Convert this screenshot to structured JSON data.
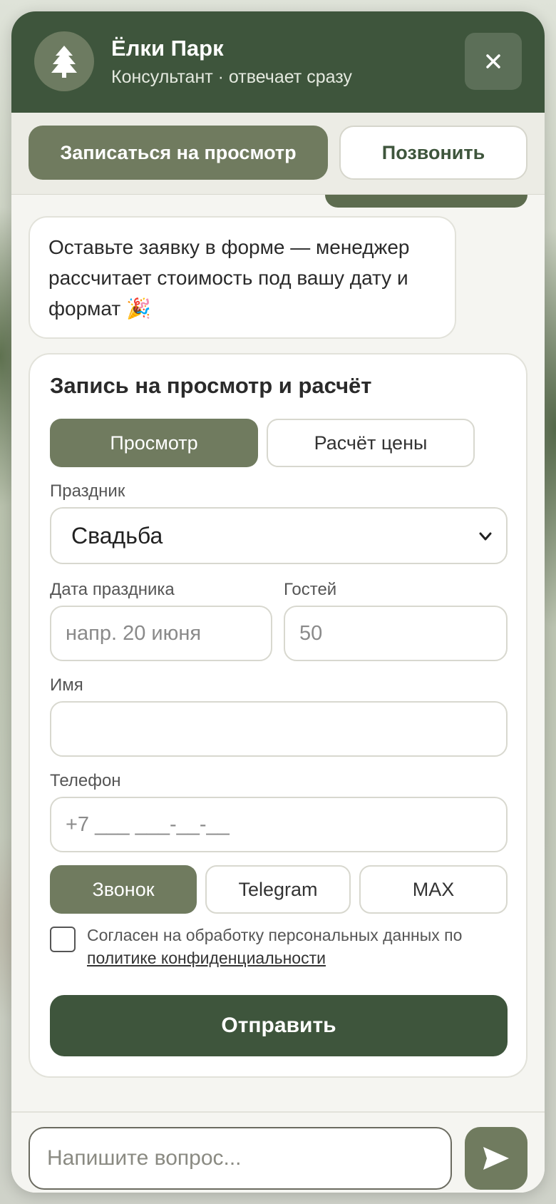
{
  "header": {
    "title": "Ёлки Парк",
    "subtitle": "Консультант · отвечает сразу",
    "avatar_icon": "tree-icon",
    "close_icon": "close-icon"
  },
  "quick_actions": {
    "primary_label": "Записаться на просмотр",
    "secondary_label": "Позвонить"
  },
  "messages": [
    {
      "text": "Оставьте заявку в форме — менеджер рассчитает стоимость под вашу дату и формат 🎉"
    }
  ],
  "form": {
    "title": "Запись на просмотр и расчёт",
    "tabs": [
      {
        "label": "Просмотр",
        "active": true
      },
      {
        "label": "Расчёт цены",
        "active": false
      }
    ],
    "holiday_label": "Праздник",
    "holiday_value": "Свадьба",
    "date_label": "Дата праздника",
    "date_placeholder": "напр. 20 июня",
    "guests_label": "Гостей",
    "guests_placeholder": "50",
    "name_label": "Имя",
    "name_value": "",
    "phone_label": "Телефон",
    "phone_placeholder": "+7 ___ ___-__-__",
    "contact_methods": [
      {
        "label": "Звонок",
        "active": true
      },
      {
        "label": "Telegram",
        "active": false
      },
      {
        "label": "MAX",
        "active": false
      }
    ],
    "consent_text": "Согласен на обработку персональных данных по",
    "consent_link": "политике конфиденциальности",
    "consent_checked": false,
    "submit_label": "Отправить"
  },
  "composer": {
    "placeholder": "Напишите вопрос...",
    "send_icon": "send-icon"
  },
  "colors": {
    "header_bg": "#3e553c",
    "accent": "#707b5f",
    "submit_bg": "#3e553c"
  }
}
